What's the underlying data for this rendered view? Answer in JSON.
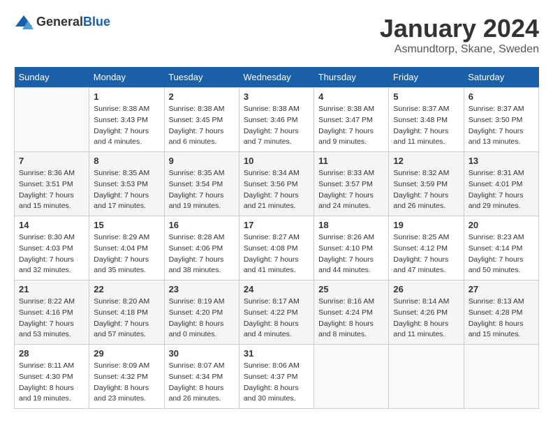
{
  "header": {
    "logo": {
      "general": "General",
      "blue": "Blue"
    },
    "title": "January 2024",
    "location": "Asmundtorp, Skane, Sweden"
  },
  "days_of_week": [
    "Sunday",
    "Monday",
    "Tuesday",
    "Wednesday",
    "Thursday",
    "Friday",
    "Saturday"
  ],
  "weeks": [
    [
      {
        "day": null
      },
      {
        "day": 1,
        "sunrise": "8:38 AM",
        "sunset": "3:43 PM",
        "daylight": "7 hours and 4 minutes."
      },
      {
        "day": 2,
        "sunrise": "8:38 AM",
        "sunset": "3:45 PM",
        "daylight": "7 hours and 6 minutes."
      },
      {
        "day": 3,
        "sunrise": "8:38 AM",
        "sunset": "3:46 PM",
        "daylight": "7 hours and 7 minutes."
      },
      {
        "day": 4,
        "sunrise": "8:38 AM",
        "sunset": "3:47 PM",
        "daylight": "7 hours and 9 minutes."
      },
      {
        "day": 5,
        "sunrise": "8:37 AM",
        "sunset": "3:48 PM",
        "daylight": "7 hours and 11 minutes."
      },
      {
        "day": 6,
        "sunrise": "8:37 AM",
        "sunset": "3:50 PM",
        "daylight": "7 hours and 13 minutes."
      }
    ],
    [
      {
        "day": 7,
        "sunrise": "8:36 AM",
        "sunset": "3:51 PM",
        "daylight": "7 hours and 15 minutes."
      },
      {
        "day": 8,
        "sunrise": "8:35 AM",
        "sunset": "3:53 PM",
        "daylight": "7 hours and 17 minutes."
      },
      {
        "day": 9,
        "sunrise": "8:35 AM",
        "sunset": "3:54 PM",
        "daylight": "7 hours and 19 minutes."
      },
      {
        "day": 10,
        "sunrise": "8:34 AM",
        "sunset": "3:56 PM",
        "daylight": "7 hours and 21 minutes."
      },
      {
        "day": 11,
        "sunrise": "8:33 AM",
        "sunset": "3:57 PM",
        "daylight": "7 hours and 24 minutes."
      },
      {
        "day": 12,
        "sunrise": "8:32 AM",
        "sunset": "3:59 PM",
        "daylight": "7 hours and 26 minutes."
      },
      {
        "day": 13,
        "sunrise": "8:31 AM",
        "sunset": "4:01 PM",
        "daylight": "7 hours and 29 minutes."
      }
    ],
    [
      {
        "day": 14,
        "sunrise": "8:30 AM",
        "sunset": "4:03 PM",
        "daylight": "7 hours and 32 minutes."
      },
      {
        "day": 15,
        "sunrise": "8:29 AM",
        "sunset": "4:04 PM",
        "daylight": "7 hours and 35 minutes."
      },
      {
        "day": 16,
        "sunrise": "8:28 AM",
        "sunset": "4:06 PM",
        "daylight": "7 hours and 38 minutes."
      },
      {
        "day": 17,
        "sunrise": "8:27 AM",
        "sunset": "4:08 PM",
        "daylight": "7 hours and 41 minutes."
      },
      {
        "day": 18,
        "sunrise": "8:26 AM",
        "sunset": "4:10 PM",
        "daylight": "7 hours and 44 minutes."
      },
      {
        "day": 19,
        "sunrise": "8:25 AM",
        "sunset": "4:12 PM",
        "daylight": "7 hours and 47 minutes."
      },
      {
        "day": 20,
        "sunrise": "8:23 AM",
        "sunset": "4:14 PM",
        "daylight": "7 hours and 50 minutes."
      }
    ],
    [
      {
        "day": 21,
        "sunrise": "8:22 AM",
        "sunset": "4:16 PM",
        "daylight": "7 hours and 53 minutes."
      },
      {
        "day": 22,
        "sunrise": "8:20 AM",
        "sunset": "4:18 PM",
        "daylight": "7 hours and 57 minutes."
      },
      {
        "day": 23,
        "sunrise": "8:19 AM",
        "sunset": "4:20 PM",
        "daylight": "8 hours and 0 minutes."
      },
      {
        "day": 24,
        "sunrise": "8:17 AM",
        "sunset": "4:22 PM",
        "daylight": "8 hours and 4 minutes."
      },
      {
        "day": 25,
        "sunrise": "8:16 AM",
        "sunset": "4:24 PM",
        "daylight": "8 hours and 8 minutes."
      },
      {
        "day": 26,
        "sunrise": "8:14 AM",
        "sunset": "4:26 PM",
        "daylight": "8 hours and 11 minutes."
      },
      {
        "day": 27,
        "sunrise": "8:13 AM",
        "sunset": "4:28 PM",
        "daylight": "8 hours and 15 minutes."
      }
    ],
    [
      {
        "day": 28,
        "sunrise": "8:11 AM",
        "sunset": "4:30 PM",
        "daylight": "8 hours and 19 minutes."
      },
      {
        "day": 29,
        "sunrise": "8:09 AM",
        "sunset": "4:32 PM",
        "daylight": "8 hours and 23 minutes."
      },
      {
        "day": 30,
        "sunrise": "8:07 AM",
        "sunset": "4:34 PM",
        "daylight": "8 hours and 26 minutes."
      },
      {
        "day": 31,
        "sunrise": "8:06 AM",
        "sunset": "4:37 PM",
        "daylight": "8 hours and 30 minutes."
      },
      {
        "day": null
      },
      {
        "day": null
      },
      {
        "day": null
      }
    ]
  ]
}
